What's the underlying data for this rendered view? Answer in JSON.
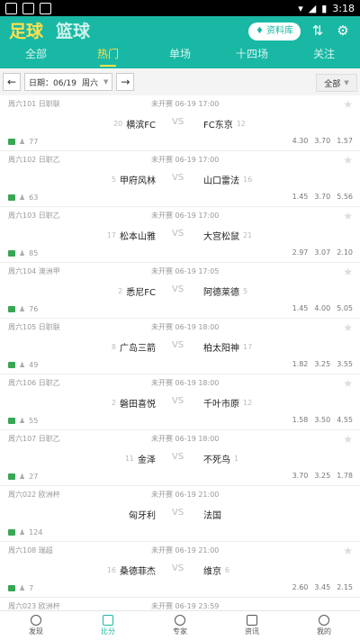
{
  "statusbar": {
    "time": "3:18"
  },
  "header": {
    "sports": [
      "足球",
      "篮球"
    ],
    "ziliao_label": "资料库",
    "tabs": [
      "全部",
      "热门",
      "单场",
      "十四场",
      "关注"
    ]
  },
  "filter": {
    "date_label": "日期：06/19",
    "weekday": "周六",
    "all_label": "全部"
  },
  "matches": [
    {
      "league": "周六101 日职联",
      "status": "未开赛",
      "time": "06-19 17:00",
      "home": "横滨FC",
      "home_rank": "20",
      "away": "FC东京",
      "away_rank": "12",
      "count": "77",
      "odds": [
        "4.30",
        "3.70",
        "1.57"
      ]
    },
    {
      "league": "周六102 日职乙",
      "status": "未开赛",
      "time": "06-19 17:00",
      "home": "甲府风林",
      "home_rank": "5",
      "away": "山口雷法",
      "away_rank": "16",
      "count": "63",
      "odds": [
        "1.45",
        "3.70",
        "5.56"
      ]
    },
    {
      "league": "周六103 日职乙",
      "status": "未开赛",
      "time": "06-19 17:00",
      "home": "松本山雅",
      "home_rank": "17",
      "away": "大宫松鼠",
      "away_rank": "21",
      "count": "85",
      "odds": [
        "2.97",
        "3.07",
        "2.10"
      ]
    },
    {
      "league": "周六104 澳洲甲",
      "status": "未开赛",
      "time": "06-19 17:05",
      "home": "悉尼FC",
      "home_rank": "2",
      "away": "阿德莱德",
      "away_rank": "5",
      "count": "76",
      "odds": [
        "1.45",
        "4.00",
        "5.05"
      ]
    },
    {
      "league": "周六105 日职联",
      "status": "未开赛",
      "time": "06-19 18:00",
      "home": "广岛三箭",
      "home_rank": "8",
      "away": "柏太阳神",
      "away_rank": "17",
      "count": "49",
      "odds": [
        "1.82",
        "3.25",
        "3.55"
      ]
    },
    {
      "league": "周六106 日职乙",
      "status": "未开赛",
      "time": "06-19 18:00",
      "home": "磐田喜悦",
      "home_rank": "2",
      "away": "千叶市原",
      "away_rank": "12",
      "count": "55",
      "odds": [
        "1.58",
        "3.50",
        "4.55"
      ]
    },
    {
      "league": "周六107 日职乙",
      "status": "未开赛",
      "time": "06-19 18:00",
      "home": "金泽",
      "home_rank": "11",
      "away": "不死鸟",
      "away_rank": "1",
      "count": "27",
      "odds": [
        "3.70",
        "3.25",
        "1.78"
      ]
    },
    {
      "league": "周六022 欧洲杯",
      "status": "未开赛",
      "time": "06-19 21:00",
      "home": "匈牙利",
      "home_rank": "",
      "away": "法国",
      "away_rank": "",
      "count": "124",
      "odds": [
        "",
        "",
        ""
      ]
    },
    {
      "league": "周六108 瑞超",
      "status": "未开赛",
      "time": "06-19 21:00",
      "home": "桑德菲杰",
      "home_rank": "16",
      "away": "维京",
      "away_rank": "6",
      "count": "7",
      "odds": [
        "2.60",
        "3.45",
        "2.15"
      ]
    },
    {
      "league": "周六023 欧洲杯",
      "status": "未开赛",
      "time": "06-19 23:59",
      "home": "",
      "home_rank": "",
      "away": "",
      "away_rank": "",
      "count": "",
      "odds": [
        "",
        "",
        ""
      ]
    }
  ],
  "nav": [
    "发现",
    "比分",
    "专家",
    "资讯",
    "我的"
  ]
}
